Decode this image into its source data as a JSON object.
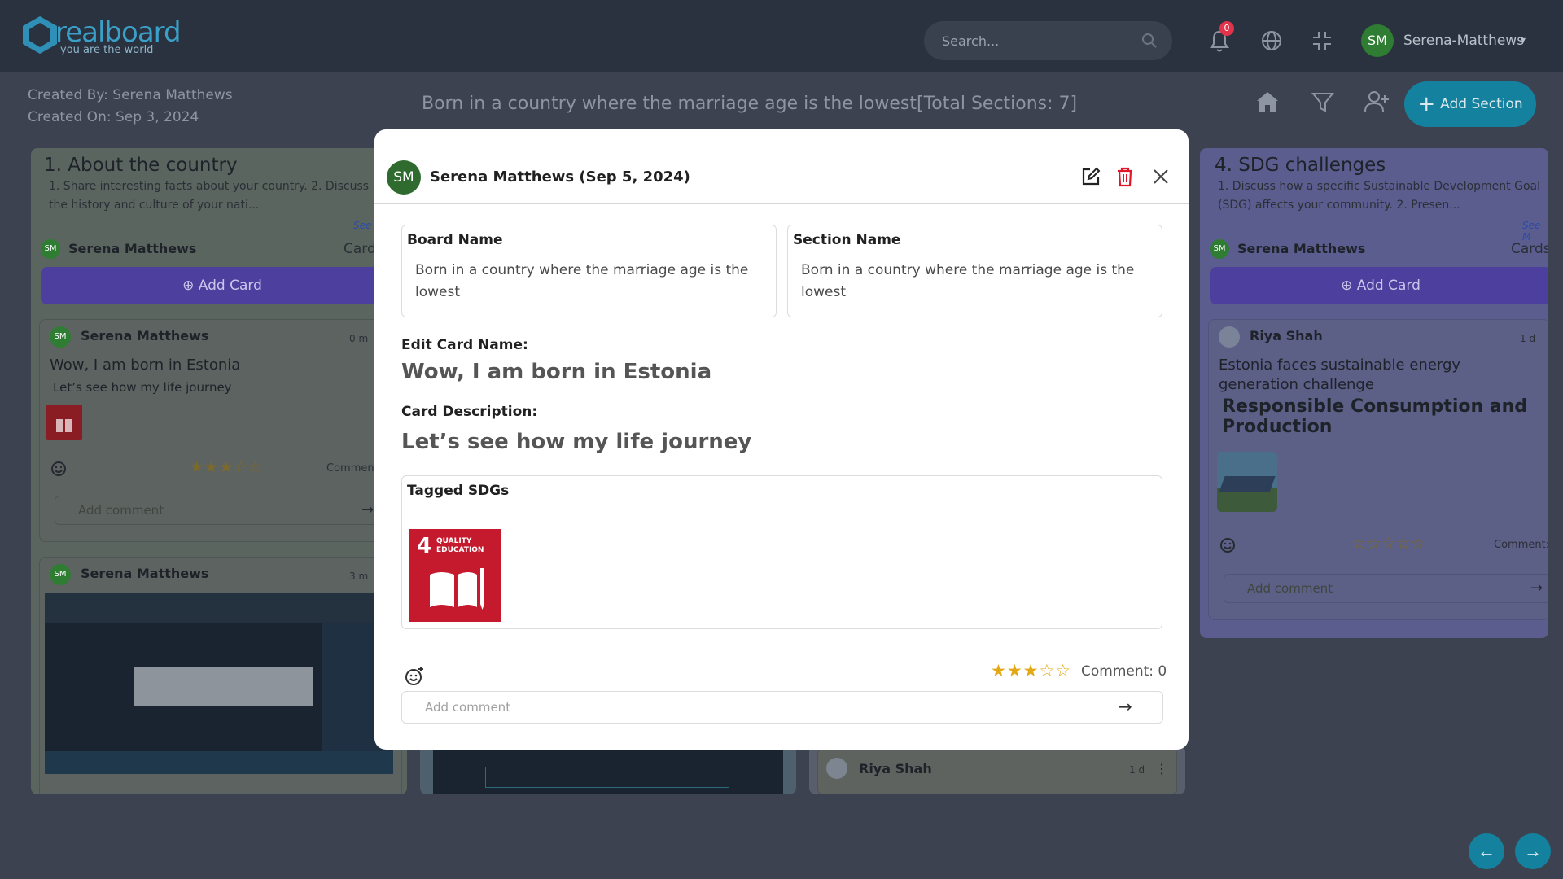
{
  "app": {
    "brand": "realboard",
    "tagline": "you are the world"
  },
  "topbar": {
    "search_placeholder": "Search...",
    "notification_count": "0",
    "user_initials": "SM",
    "user_name": "Serena-Matthews"
  },
  "board": {
    "created_by": "Created By: Serena Matthews",
    "created_on": "Created On: Sep 3, 2024",
    "title": "Born in a country where the marriage age is the lowest[Total Sections: 7]",
    "add_section_label": "Add Section"
  },
  "columns": [
    {
      "title": "1. About the country",
      "description": "1. Share interesting facts about your country. 2. Discuss the history and culture of your nati...",
      "see_more": "See",
      "owner_initials": "SM",
      "owner": "Serena Matthews",
      "cards_label": "Card",
      "add_card_label": "Add Card",
      "cards": [
        {
          "initials": "SM",
          "user": "Serena Matthews",
          "time": "0 m",
          "title": "Wow, I am born in Estonia",
          "description": "Let’s see how my life journey",
          "rating": 3,
          "comment_label": "Comment",
          "comment_placeholder": "Add comment"
        },
        {
          "initials": "SM",
          "user": "Serena Matthews",
          "time": "3 m"
        }
      ]
    },
    {
      "title": "4. SDG challenges",
      "description": "1. Discuss how a specific Sustainable Development Goal (SDG) affects your community. 2. Presen...",
      "see_more": "See M",
      "owner_initials": "SM",
      "owner": "Serena Matthews",
      "cards_label": "Cards",
      "add_card_label": "Add Card",
      "cards": [
        {
          "user": "Riya Shah",
          "time": "1 d",
          "title": "Estonia faces sustainable energy generation challenge",
          "subtitle": "Responsible Consumption and Production",
          "rating": 0,
          "comment_label": "Comment:",
          "comment_placeholder": "Add comment"
        }
      ]
    }
  ],
  "background_cards": {
    "riya_card_user": "Riya Shah",
    "riya_card_time": "1 d"
  },
  "modal": {
    "initials": "SM",
    "header": "Serena Matthews (Sep 5, 2024)",
    "board_name_label": "Board Name",
    "board_name_value": "Born in a country where the marriage age is the lowest",
    "section_name_label": "Section Name",
    "section_name_value": "Born in a country where the marriage age is the lowest",
    "edit_card_label": "Edit Card Name:",
    "card_name": "Wow, I am born in Estonia",
    "card_desc_label": "Card Description:",
    "card_desc": "Let’s see how my life journey",
    "tagged_label": "Tagged SDGs",
    "sdg_number": "4",
    "sdg_name": "QUALITY EDUCATION",
    "rating": 3,
    "comment_count": "Comment: 0",
    "comment_placeholder": "Add comment"
  },
  "colors": {
    "accent": "#14829e",
    "sdg4": "#c5192d",
    "star": "#e3a815"
  }
}
